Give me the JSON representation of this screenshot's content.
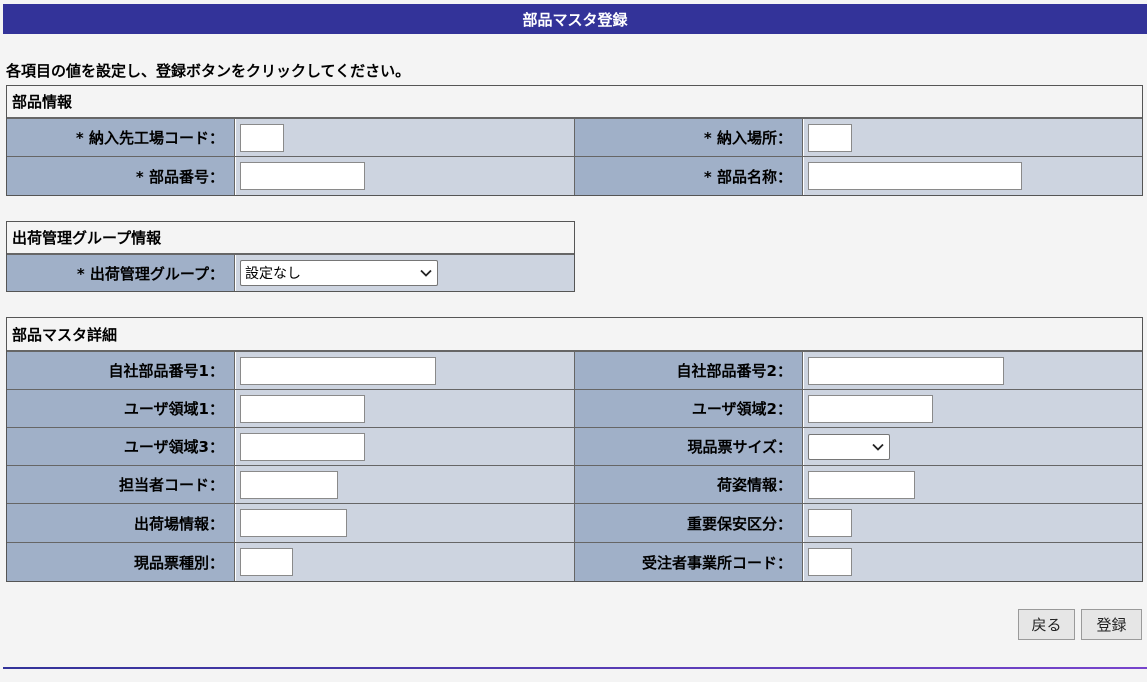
{
  "title": "部品マスタ登録",
  "instruction": "各項目の値を設定し、登録ボタンをクリックしてください。",
  "section1": {
    "heading": "部品情報",
    "rows": [
      [
        {
          "label": "* 納入先工場コード：",
          "value": ""
        },
        {
          "label": "* 納入場所：",
          "value": ""
        }
      ],
      [
        {
          "label": "* 部品番号：",
          "value": ""
        },
        {
          "label": "* 部品名称：",
          "value": ""
        }
      ]
    ]
  },
  "section2": {
    "heading": "出荷管理グループ情報",
    "label": "* 出荷管理グループ：",
    "selected": "設定なし"
  },
  "section3": {
    "heading": "部品マスタ詳細",
    "rows": [
      [
        {
          "label": "自社部品番号1：",
          "value": ""
        },
        {
          "label": "自社部品番号2：",
          "value": ""
        }
      ],
      [
        {
          "label": "ユーザ領域1：",
          "value": ""
        },
        {
          "label": "ユーザ領域2：",
          "value": ""
        }
      ],
      [
        {
          "label": "ユーザ領域3：",
          "value": ""
        },
        {
          "label": "現品票サイズ：",
          "selected": ""
        }
      ],
      [
        {
          "label": "担当者コード：",
          "value": ""
        },
        {
          "label": "荷姿情報：",
          "value": ""
        }
      ],
      [
        {
          "label": "出荷場情報：",
          "value": ""
        },
        {
          "label": "重要保安区分：",
          "value": ""
        }
      ],
      [
        {
          "label": "現品票種別：",
          "value": ""
        },
        {
          "label": "受注者事業所コード：",
          "value": ""
        }
      ]
    ]
  },
  "buttons": {
    "back": "戻る",
    "register": "登録"
  },
  "colors": {
    "titlebar": "#333399",
    "label_bg": "#a0b0c8",
    "value_bg": "#cdd4e0"
  }
}
